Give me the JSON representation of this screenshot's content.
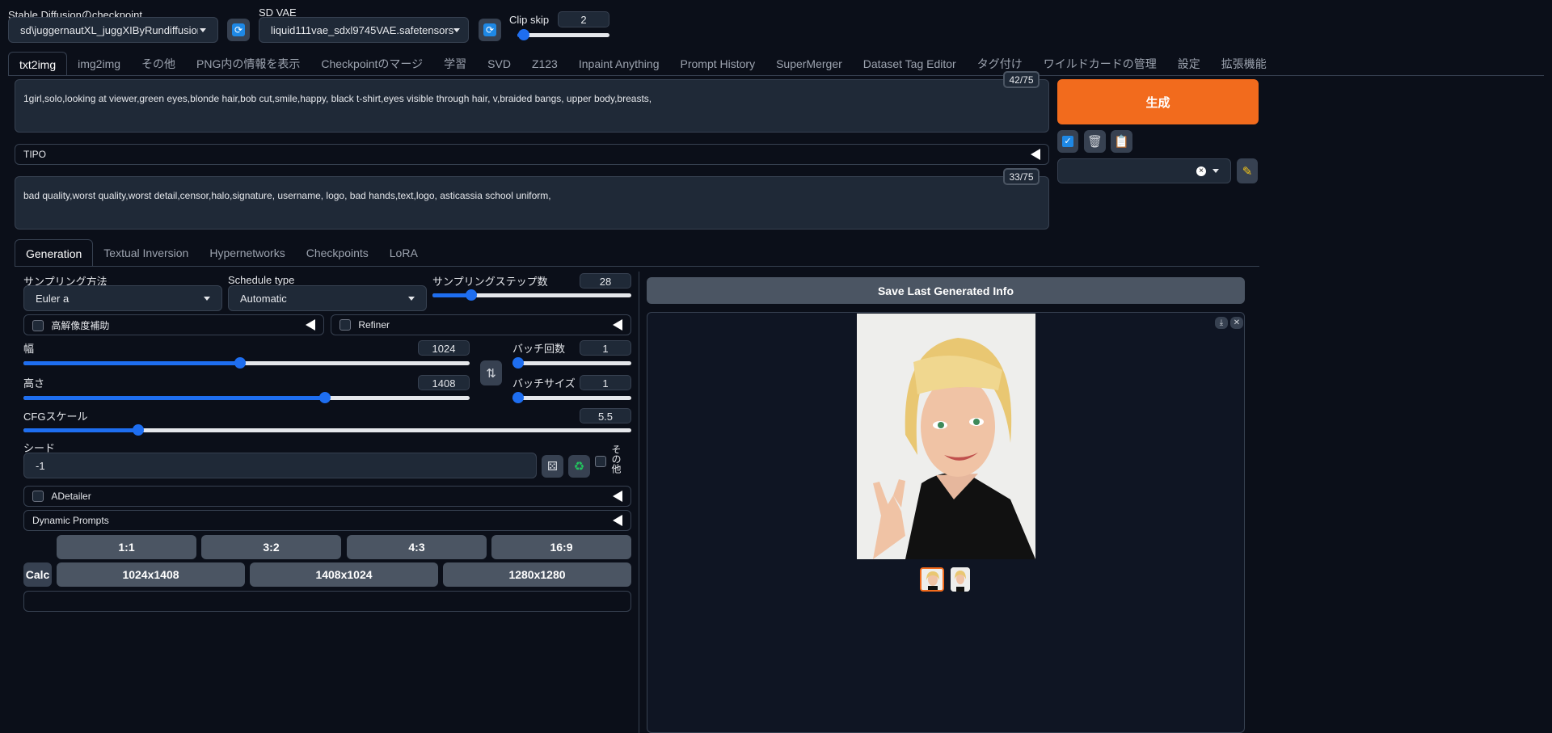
{
  "top": {
    "checkpoint_label": "Stable Diffusionのcheckpoint",
    "checkpoint_value": "sd\\juggernautXL_juggXIByRundiffusion.safeten",
    "vae_label": "SD VAE",
    "vae_value": "liquid111vae_sdxl9745VAE.safetensors",
    "clip_skip_label": "Clip skip",
    "clip_skip_value": "2",
    "clip_skip_fraction": 0.08
  },
  "main_tabs": [
    "txt2img",
    "img2img",
    "その他",
    "PNG内の情報を表示",
    "Checkpointのマージ",
    "学習",
    "SVD",
    "Z123",
    "Inpaint Anything",
    "Prompt History",
    "SuperMerger",
    "Dataset Tag Editor",
    "タグ付け",
    "ワイルドカードの管理",
    "設定",
    "拡張機能"
  ],
  "prompt": {
    "text": "1girl,solo,looking at viewer,green eyes,blonde hair,bob cut,smile,happy, black t-shirt,eyes visible through hair, v,braided bangs, upper body,breasts,",
    "counter": "42/75"
  },
  "tipo_label": "TIPO",
  "negative": {
    "text": "bad quality,worst quality,worst detail,censor,halo,signature, username, logo, bad hands,text,logo, asticassia school uniform,",
    "counter": "33/75"
  },
  "generate_label": "生成",
  "sub_tabs": [
    "Generation",
    "Textual Inversion",
    "Hypernetworks",
    "Checkpoints",
    "LoRA"
  ],
  "sampling": {
    "method_label": "サンプリング方法",
    "method_value": "Euler a",
    "schedule_label": "Schedule type",
    "schedule_value": "Automatic",
    "steps_label": "サンプリングステップ数",
    "steps_value": "28"
  },
  "hires_label": "高解像度補助",
  "refiner_label": "Refiner",
  "width": {
    "label": "幅",
    "value": "1024"
  },
  "height": {
    "label": "高さ",
    "value": "1408"
  },
  "batch_count": {
    "label": "バッチ回数",
    "value": "1"
  },
  "batch_size": {
    "label": "バッチサイズ",
    "value": "1"
  },
  "cfg": {
    "label": "CFGスケール",
    "value": "5.5"
  },
  "seed": {
    "label": "シード",
    "value": "-1",
    "extra_label": "その他"
  },
  "adetailer_label": "ADetailer",
  "dynamic_prompts_label": "Dynamic Prompts",
  "aspect_buttons": [
    "1:1",
    "3:2",
    "4:3",
    "16:9"
  ],
  "calc_label": "Calc",
  "size_buttons": [
    "1024x1408",
    "1408x1024",
    "1280x1280"
  ],
  "save_info_label": "Save Last Generated Info",
  "colors": {
    "accent": "#1e6ef0",
    "generate": "#f26b1d"
  }
}
